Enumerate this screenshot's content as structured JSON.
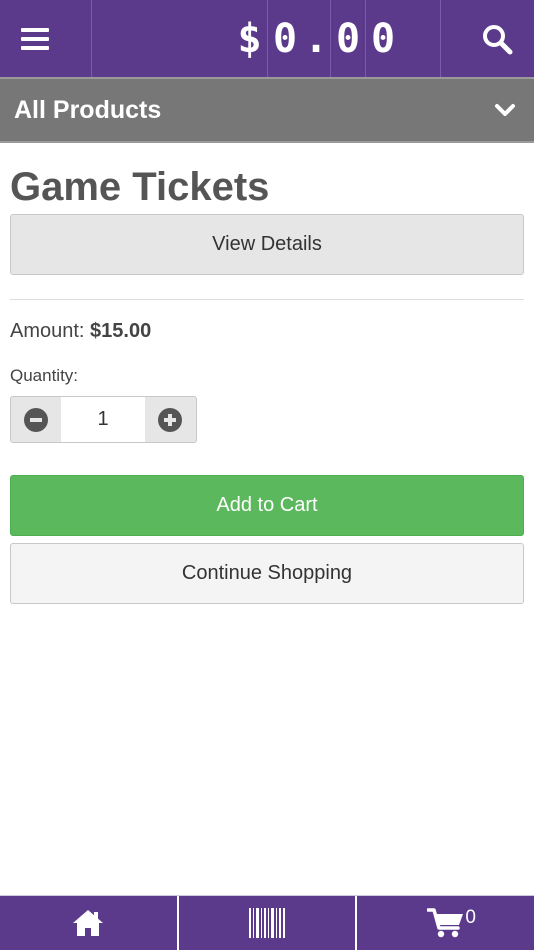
{
  "header": {
    "menu_icon": "hamburger-menu-icon",
    "balance_chars": [
      "$",
      "0",
      ".",
      "0",
      "0"
    ],
    "search_icon": "search-icon"
  },
  "category": {
    "label": "All Products",
    "icon": "chevron-down-icon"
  },
  "product": {
    "title": "Game Tickets",
    "view_details_label": "View Details",
    "amount_label": "Amount:",
    "amount_value": "$15.00",
    "quantity_label": "Quantity:",
    "quantity_value": "1"
  },
  "actions": {
    "add_to_cart_label": "Add to Cart",
    "continue_label": "Continue Shopping"
  },
  "footer": {
    "home_icon": "home-icon",
    "barcode_icon": "barcode-icon",
    "cart_icon": "cart-icon",
    "cart_count": "0"
  },
  "colors": {
    "brand_purple": "#5b3a8c",
    "category_grey": "#777777",
    "success_green": "#5cb85c"
  }
}
